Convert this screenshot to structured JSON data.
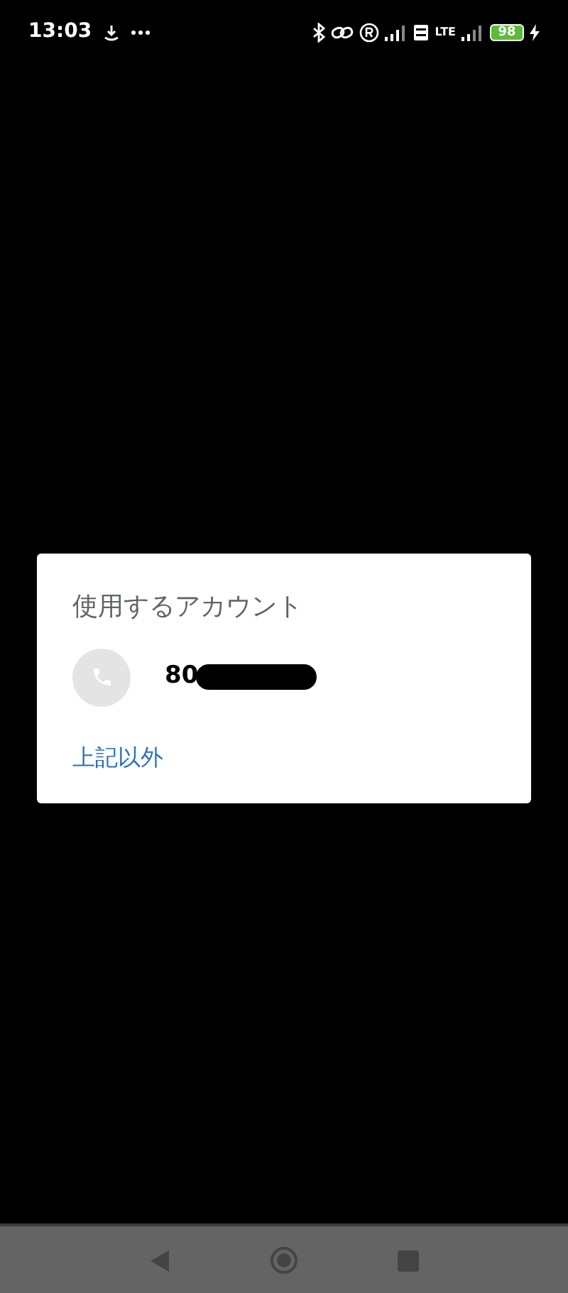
{
  "status_bar": {
    "time": "13:03",
    "network": "LTE",
    "battery": "98",
    "charging": true
  },
  "dialog": {
    "title": "使用するアカウント",
    "accounts": [
      {
        "number": "80",
        "redacted": true
      }
    ],
    "other_link": "上記以外"
  },
  "nav_bar": {
    "buttons": [
      {
        "kind": "back"
      },
      {
        "kind": "home"
      },
      {
        "kind": "recents"
      }
    ]
  }
}
